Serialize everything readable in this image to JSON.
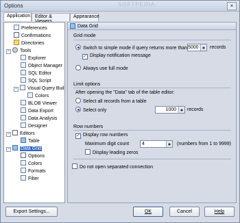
{
  "window": {
    "title": "Options",
    "close_glyph": "×",
    "watermark": "SOFTPEDIA"
  },
  "tabs": [
    {
      "label": "Application",
      "active": true
    },
    {
      "label": "Editor & Viewers",
      "active": false
    },
    {
      "label": "Appearance",
      "active": false
    }
  ],
  "tree": [
    {
      "label": "Preferences",
      "icon": "preferences-icon"
    },
    {
      "label": "Confirmations",
      "icon": "confirmations-icon"
    },
    {
      "label": "Directories",
      "icon": "directories-icon"
    },
    {
      "label": "Tools",
      "icon": "tools-icon",
      "expander": "−"
    },
    {
      "label": "Explorer",
      "icon": "explorer-icon"
    },
    {
      "label": "Object Manager",
      "icon": "object-manager-icon"
    },
    {
      "label": "SQL Editor",
      "icon": "sql-editor-icon"
    },
    {
      "label": "SQL Script",
      "icon": "sql-script-icon"
    },
    {
      "label": "Visual Query Buil",
      "icon": "visual-query-builder-icon",
      "expander": "−"
    },
    {
      "label": "Colors",
      "icon": "colors-icon"
    },
    {
      "label": "BLOB Viewer",
      "icon": "blob-viewer-icon"
    },
    {
      "label": "Data Export",
      "icon": "data-export-icon"
    },
    {
      "label": "Data Analysis",
      "icon": "data-analysis-icon"
    },
    {
      "label": "Designer",
      "icon": "designer-icon"
    },
    {
      "label": "Editors",
      "icon": "editors-icon",
      "expander": "−"
    },
    {
      "label": "Table",
      "icon": "table-icon"
    },
    {
      "label": "Data Grid",
      "icon": "data-grid-icon",
      "expander": "−",
      "selected": true
    },
    {
      "label": "Options",
      "icon": "options-icon"
    },
    {
      "label": "Colors",
      "icon": "colors-icon"
    },
    {
      "label": "Formats",
      "icon": "formats-icon"
    },
    {
      "label": "Filter",
      "icon": "filter-icon"
    }
  ],
  "panel": {
    "header": "Data Grid",
    "grid_mode": {
      "title": "Grid mode",
      "switch_label": "Switch to simple mode if query returns more than",
      "switch_value": "5000",
      "switch_unit": "records",
      "notify_label": "Display notification message",
      "notify_checked": true,
      "always_full_label": "Always use full mode"
    },
    "limit_options": {
      "title": "Limit options",
      "intro": "After opening the \"Data\" tab of the table editor:",
      "select_all_label": "Select all records from a table",
      "select_only_label": "Select only",
      "select_only_value": "1000",
      "select_only_unit": "records"
    },
    "row_numbers": {
      "title": "Row numbers",
      "display_label": "Display row numbers",
      "display_checked": true,
      "max_digit_label": "Maximum digit count",
      "max_digit_value": "4",
      "max_digit_hint": "(numbers from 1 to 9999)",
      "leading_zeros_label": "Display leading zeros"
    },
    "separated_connection_label": "Do not open separated connection"
  },
  "buttons": {
    "export_settings": "Export Settings...",
    "ok": "OK",
    "cancel": "Cancel",
    "help": "Help"
  },
  "colors": {
    "selection": "#3169c6",
    "window_bg": "#d6dbe6"
  }
}
